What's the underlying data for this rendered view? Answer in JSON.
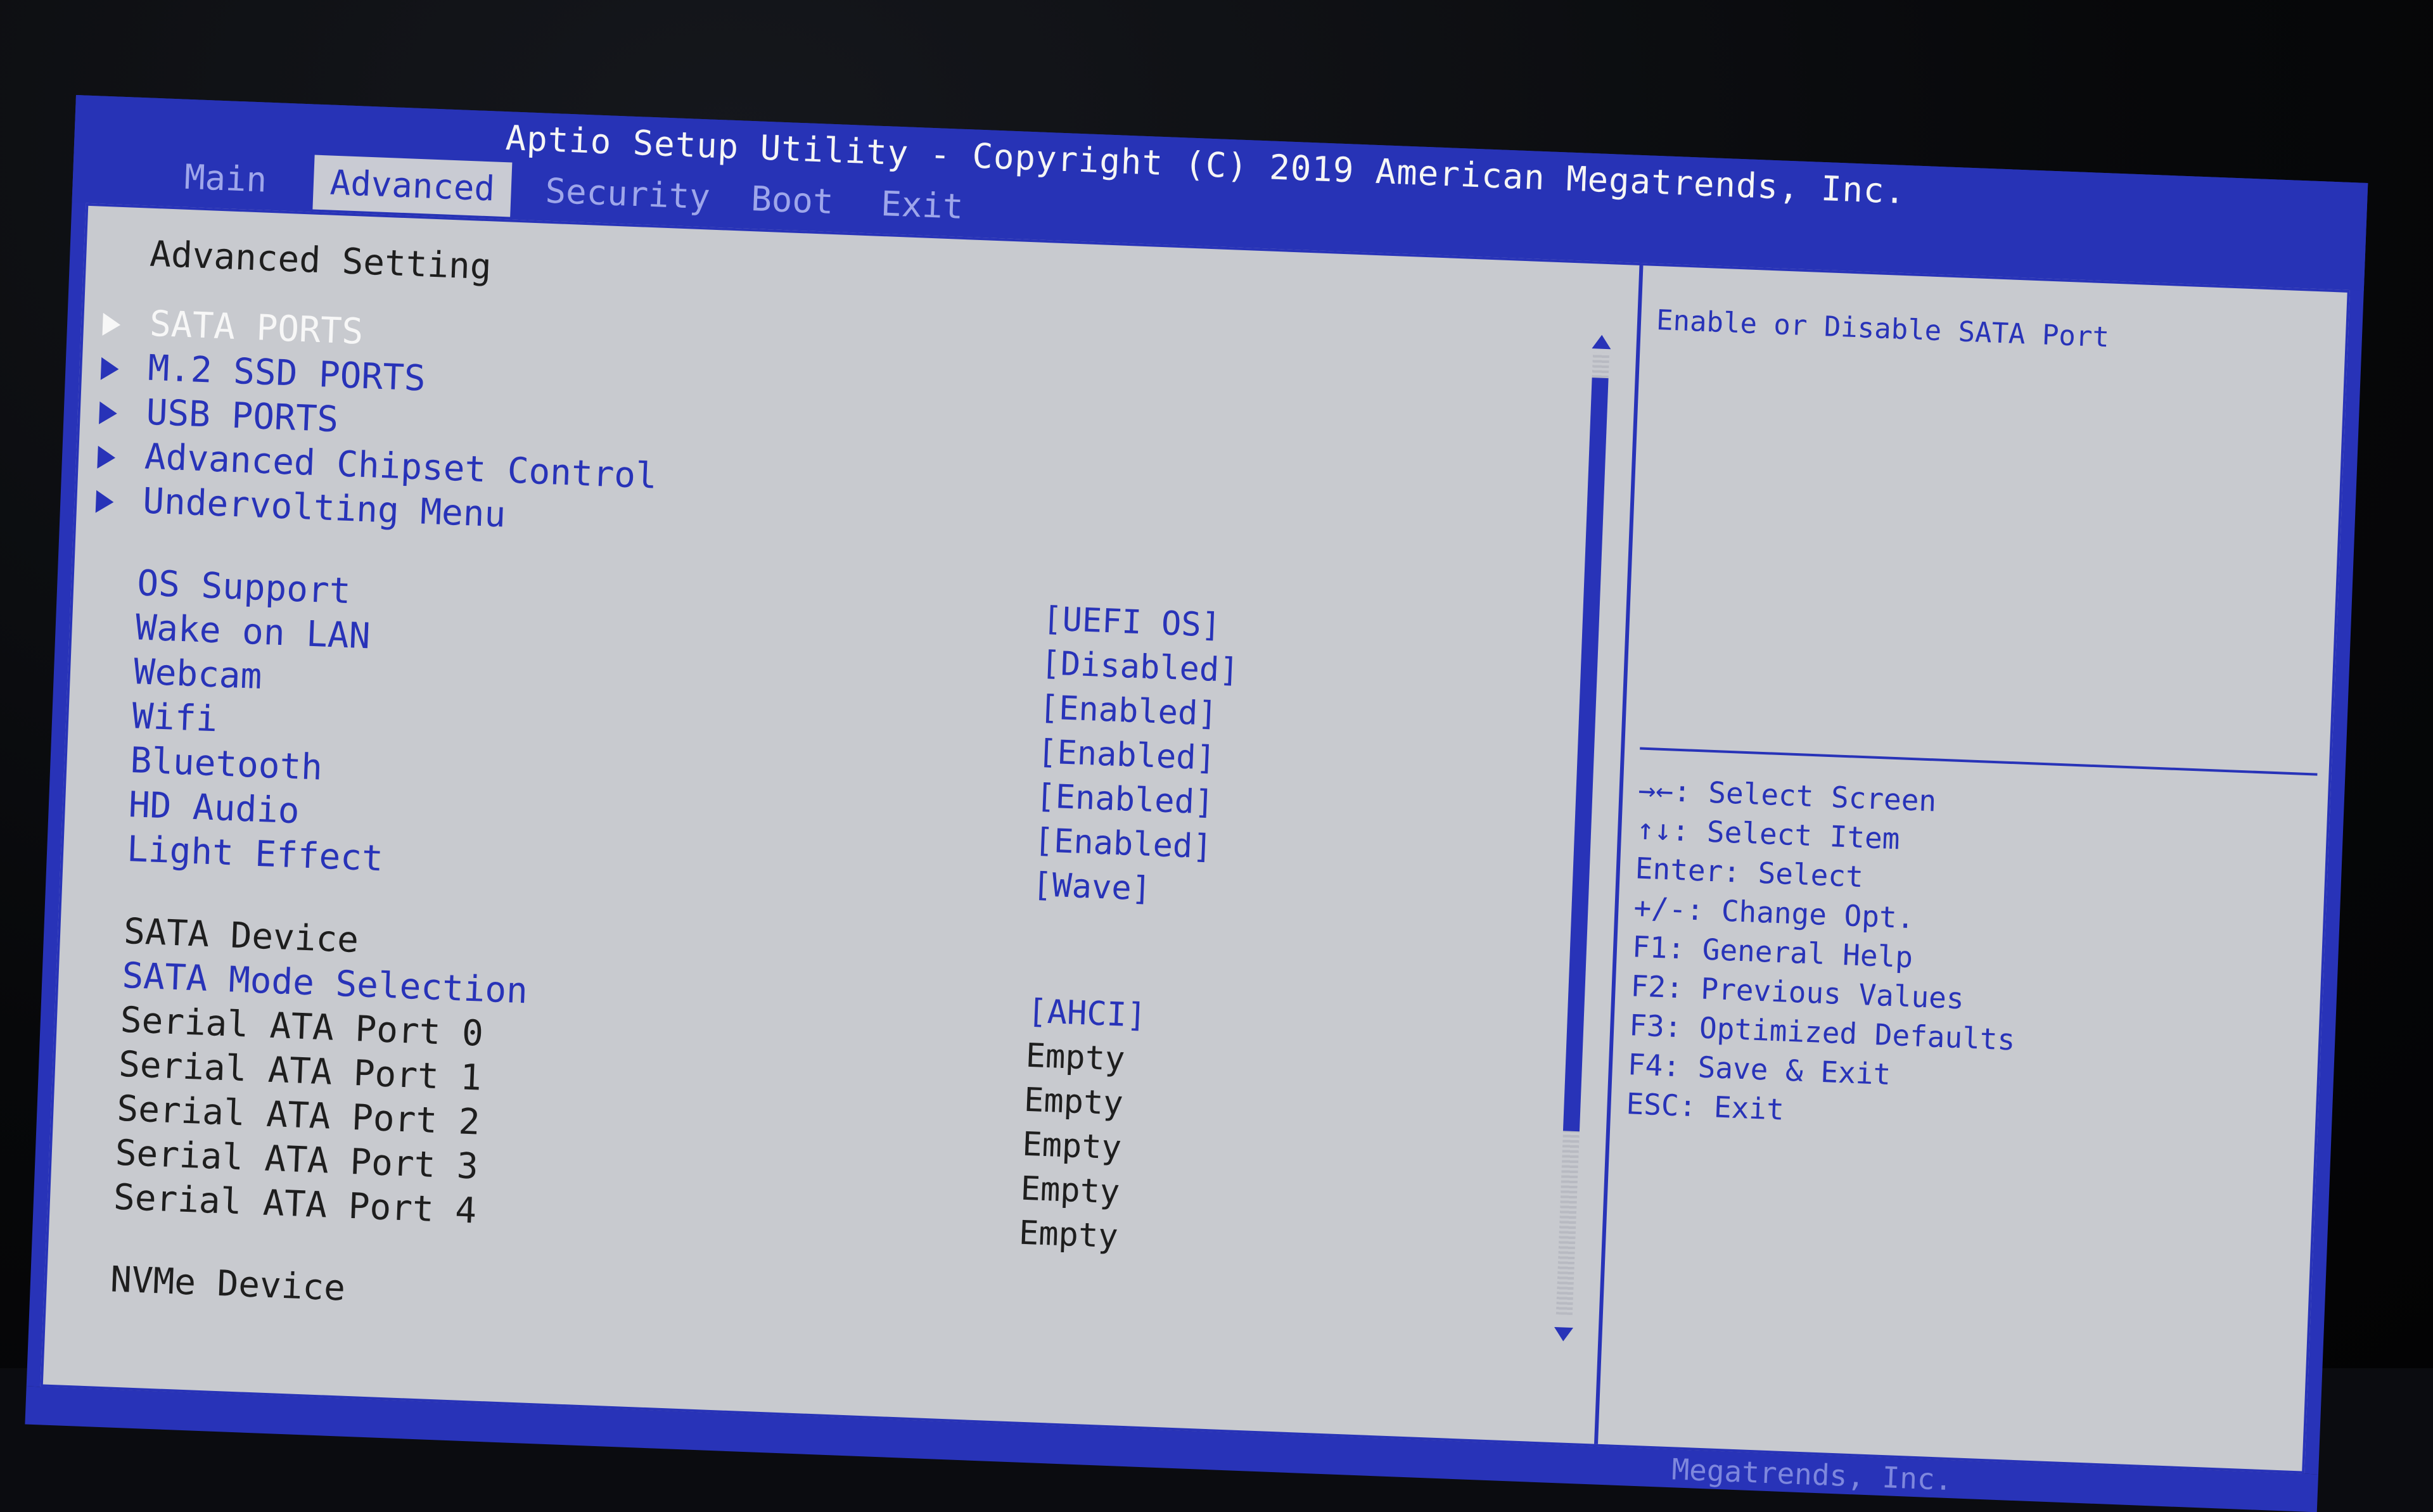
{
  "app": {
    "title": "Aptio Setup Utility - Copyright (C) 2019 American Megatrends, Inc."
  },
  "tabs": [
    {
      "label": "Main",
      "active": false
    },
    {
      "label": "Advanced",
      "active": true
    },
    {
      "label": "Security",
      "active": false
    },
    {
      "label": "Boot",
      "active": false
    },
    {
      "label": "Exit",
      "active": false
    }
  ],
  "page": {
    "heading": "Advanced Setting"
  },
  "submenus": [
    {
      "label": "SATA PORTS",
      "selected": true
    },
    {
      "label": "M.2 SSD PORTS",
      "selected": false
    },
    {
      "label": "USB PORTS",
      "selected": false
    },
    {
      "label": "Advanced Chipset Control",
      "selected": false
    },
    {
      "label": "Undervolting Menu",
      "selected": false
    }
  ],
  "options": [
    {
      "label": "OS Support",
      "value": "[UEFI OS]"
    },
    {
      "label": "Wake on LAN",
      "value": "[Disabled]"
    },
    {
      "label": "Webcam",
      "value": "[Enabled]"
    },
    {
      "label": "Wifi",
      "value": "[Enabled]"
    },
    {
      "label": "Bluetooth",
      "value": "[Enabled]"
    },
    {
      "label": "HD Audio",
      "value": "[Enabled]"
    },
    {
      "label": "Light Effect",
      "value": "[Wave]"
    }
  ],
  "sata": {
    "heading": "SATA Device",
    "mode_label": "SATA Mode Selection",
    "mode_value": "[AHCI]",
    "ports": [
      {
        "label": "Serial ATA Port 0",
        "value": "Empty"
      },
      {
        "label": "Serial ATA Port 1",
        "value": "Empty"
      },
      {
        "label": "Serial ATA Port 2",
        "value": "Empty"
      },
      {
        "label": "Serial ATA Port 3",
        "value": "Empty"
      },
      {
        "label": "Serial ATA Port 4",
        "value": "Empty"
      }
    ]
  },
  "nvme": {
    "heading": "NVMe Device"
  },
  "help": {
    "text": "Enable or Disable SATA Port"
  },
  "keys": [
    "→←: Select Screen",
    "↑↓: Select Item",
    "Enter: Select",
    "+/-: Change Opt.",
    "F1: General Help",
    "F2: Previous Values",
    "F3: Optimized Defaults",
    "F4: Save & Exit",
    "ESC: Exit"
  ],
  "footer": {
    "text": "Megatrends, Inc."
  },
  "colors": {
    "bios_blue": "#2833b8",
    "panel_gray": "#c8cacf",
    "selected_white": "#f7f7f7"
  }
}
